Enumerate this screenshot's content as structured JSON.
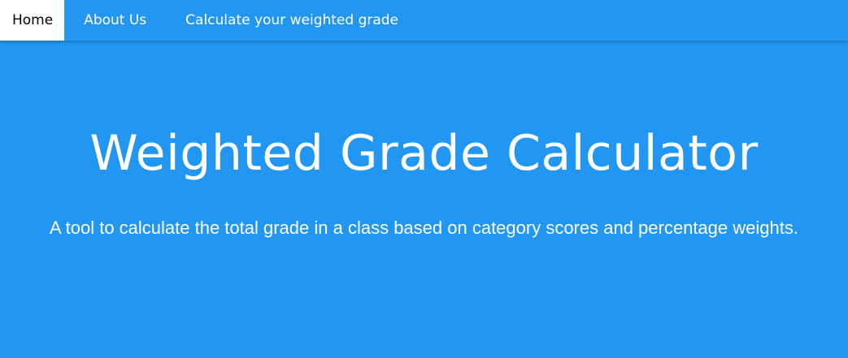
{
  "nav": {
    "items": [
      {
        "label": "Home",
        "active": true
      },
      {
        "label": "About Us",
        "active": false
      },
      {
        "label": "Calculate your weighted grade",
        "active": false
      }
    ]
  },
  "hero": {
    "title": "Weighted Grade Calculator",
    "subtitle": "A tool to calculate the total grade in a class based on category scores and percentage weights."
  },
  "colors": {
    "primary": "#2196F3",
    "active_tab_bg": "#ffffff",
    "text_light": "#ffffff",
    "text_dark": "#000000"
  }
}
